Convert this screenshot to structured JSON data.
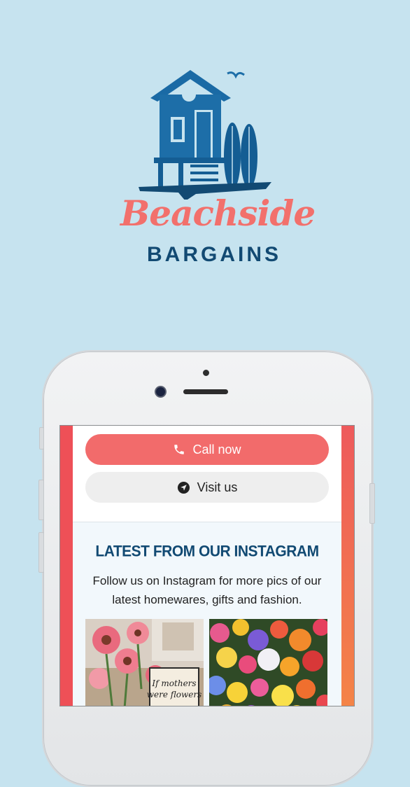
{
  "brand": {
    "script_name": "Beachside",
    "sub_name": "BARGAINS"
  },
  "screen": {
    "call_button": {
      "label": "Call now",
      "icon": "phone-icon"
    },
    "visit_button": {
      "label": "Visit us",
      "icon": "location-arrow-icon"
    },
    "instagram": {
      "title": "LATEST FROM OUR INSTAGRAM",
      "description": "Follow us on Instagram for more pics of our latest homewares, gifts and fashion.",
      "photos": [
        {
          "alt_text_on_sign": "If mothers were flowers"
        },
        {
          "alt_text_on_sign": ""
        }
      ]
    }
  },
  "colors": {
    "background": "#c6e3ef",
    "brand_coral": "#f2706c",
    "brand_navy": "#124a73",
    "call_button": "#f26b6b"
  }
}
